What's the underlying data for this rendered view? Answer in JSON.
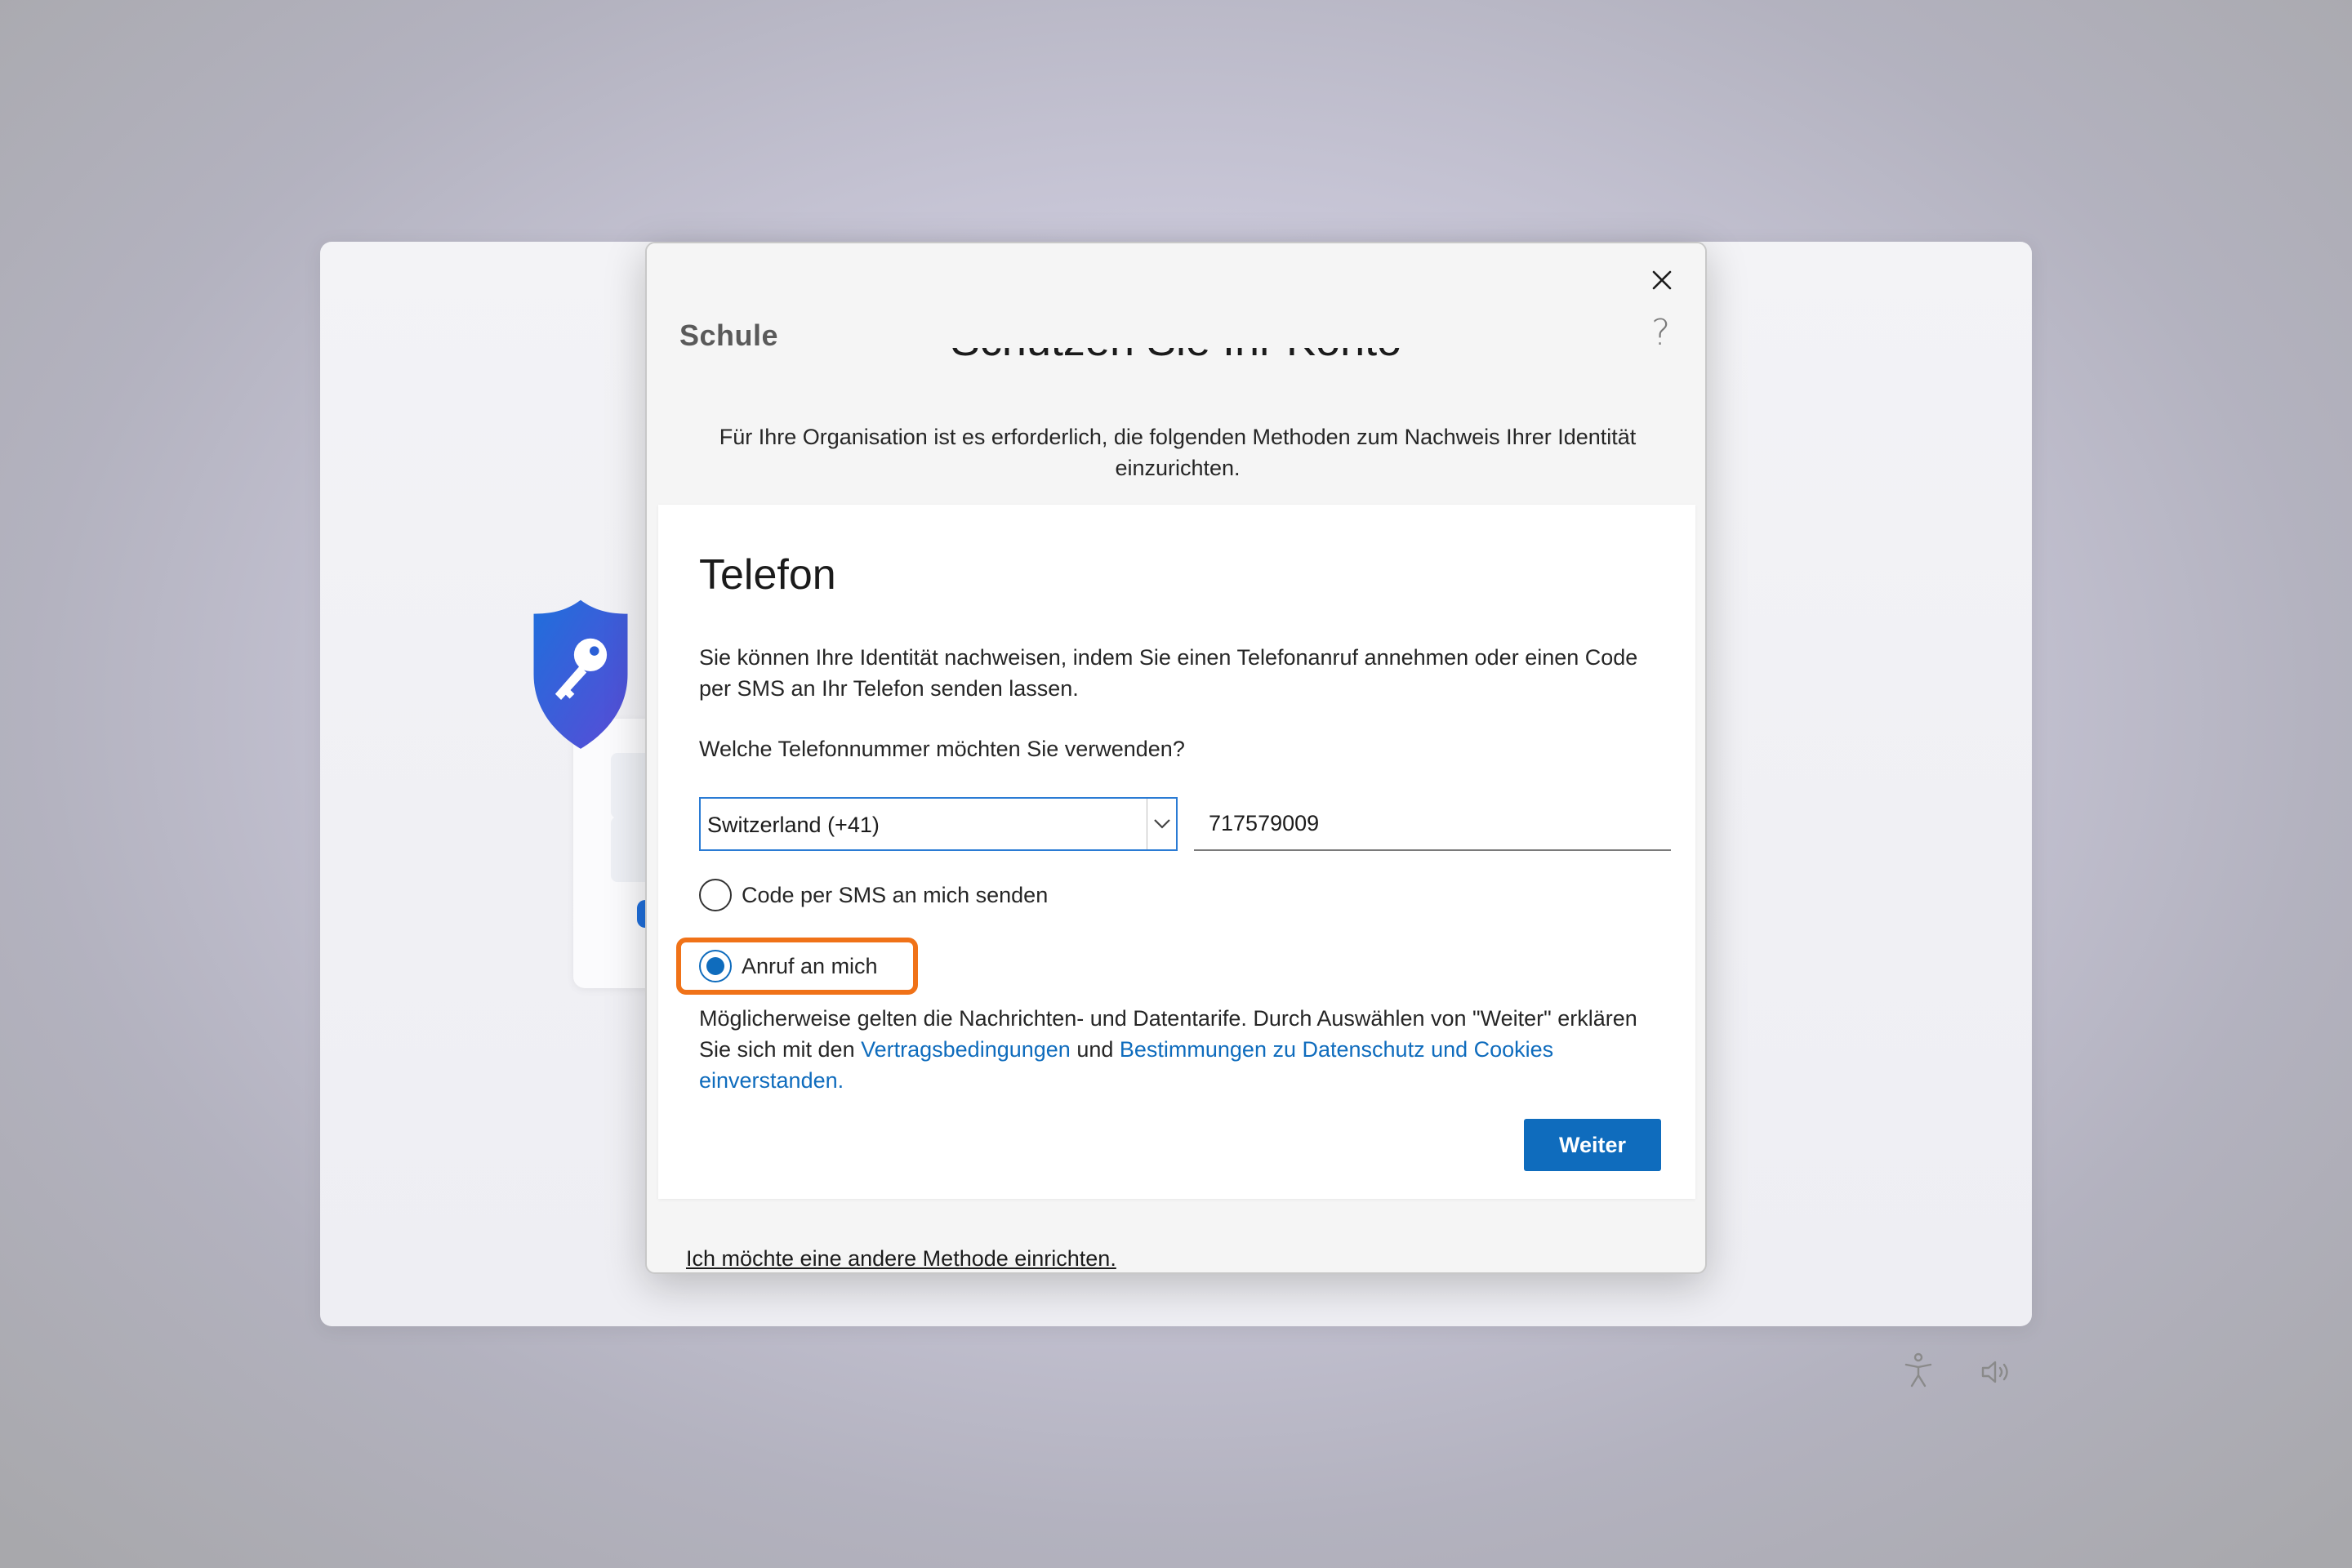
{
  "dialog": {
    "org_name": "Schule",
    "help_glyph": "?",
    "hidden_heading": "Schützen Sie Ihr Konto",
    "intro": "Für Ihre Organisation ist es erforderlich, die folgenden Methoden zum Nachweis Ihrer Identität einzurichten.",
    "other_method_link": "Ich möchte eine andere Methode einrichten."
  },
  "card": {
    "title": "Telefon",
    "description": "Sie können Ihre Identität nachweisen, indem Sie einen Telefonanruf annehmen oder einen Code per SMS an Ihr Telefon senden lassen.",
    "question": "Welche Telefonnummer möchten Sie verwenden?",
    "country_value": "Switzerland (+41)",
    "phone_value": "717579009",
    "options": [
      {
        "label": "Code per SMS an mich senden",
        "selected": false
      },
      {
        "label": "Anruf an mich",
        "selected": true
      }
    ],
    "terms_prefix": "Möglicherweise gelten die Nachrichten- und Datentarife. Durch Auswählen von \"Weiter\" erklären Sie sich mit den ",
    "terms_link1": "Vertragsbedingungen",
    "terms_middle": " und ",
    "terms_link2": "Bestimmungen zu Datenschutz und Cookies einverstanden.",
    "next_label": "Weiter"
  },
  "icons": {
    "close": "close-icon",
    "help": "help-icon",
    "dropdown": "chevron-down-icon",
    "accessibility": "accessibility-icon",
    "volume": "volume-icon",
    "hero": "shield-key-icon"
  },
  "colors": {
    "accent": "#0f6cbd",
    "highlight": "#f07218",
    "shield_top": "#1f6fdc",
    "shield_bottom": "#5a4bd6"
  }
}
